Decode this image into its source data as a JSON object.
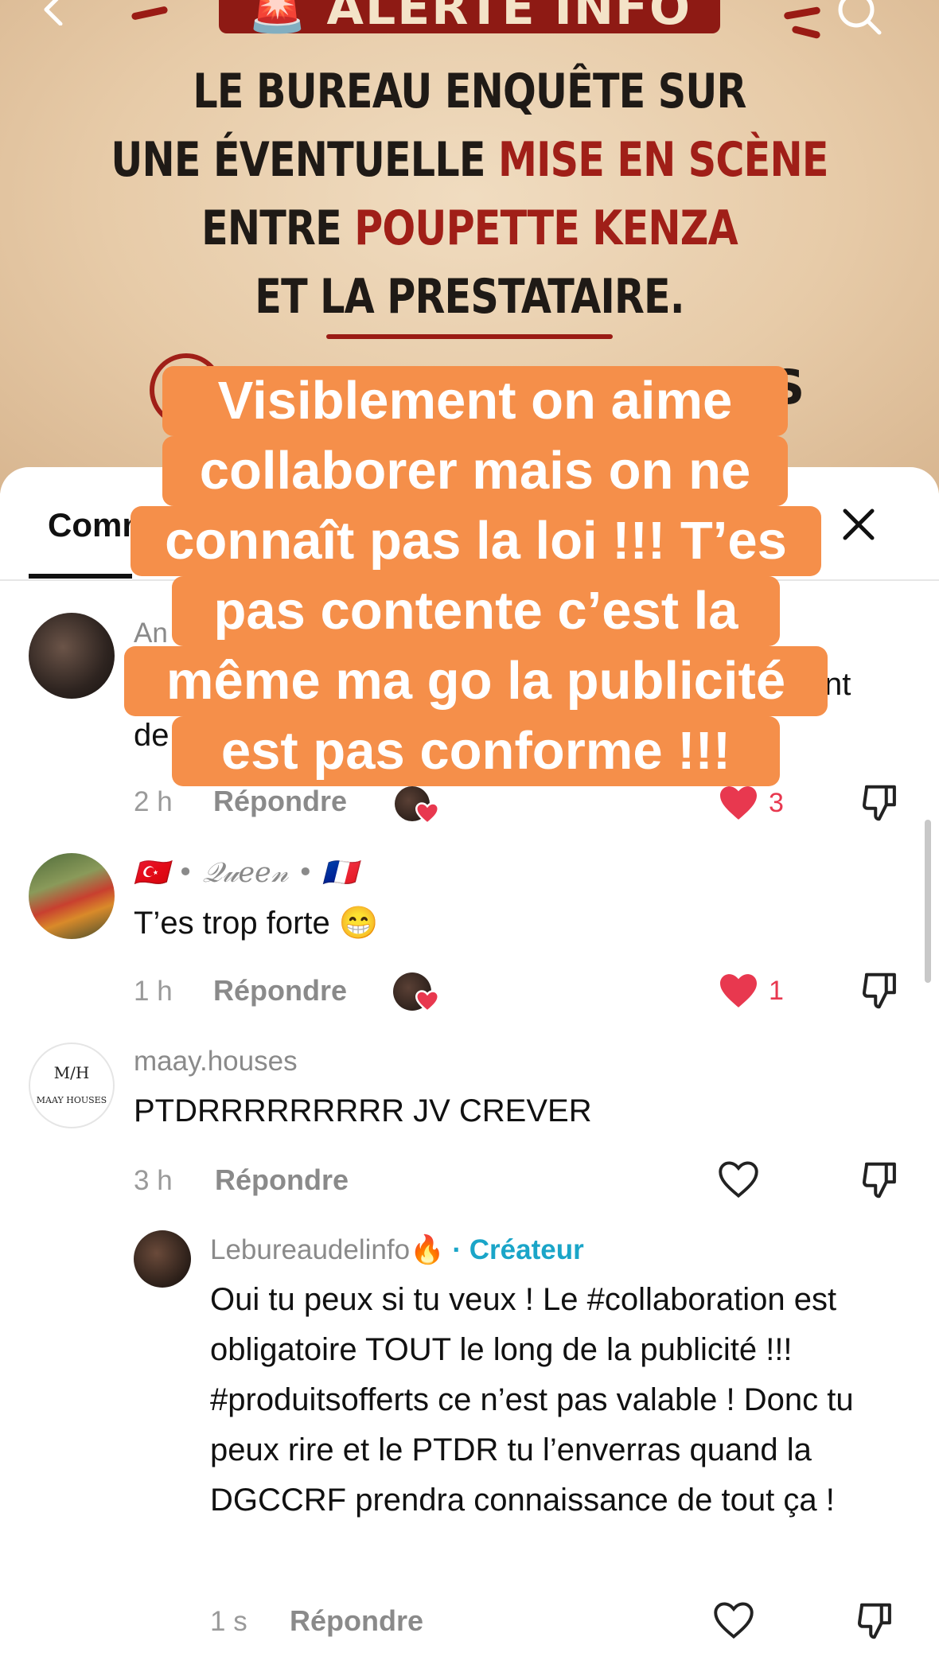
{
  "poster": {
    "banner": "ALERTE INFO",
    "lines": [
      {
        "parts": [
          {
            "text": "LE BUREAU ENQUÊTE SUR",
            "hl": false
          }
        ]
      },
      {
        "parts": [
          {
            "text": "UNE ÉVENTUELLE ",
            "hl": false
          },
          {
            "text": "MISE EN SCÈNE",
            "hl": true
          }
        ]
      },
      {
        "parts": [
          {
            "text": "ENTRE ",
            "hl": false
          },
          {
            "text": "POUPETTE KENZA",
            "hl": true
          }
        ]
      },
      {
        "parts": [
          {
            "text": "ET LA PRESTATAIRE.",
            "hl": false
          }
        ]
      }
    ],
    "trailing_letter": "S"
  },
  "overlay_caption": {
    "lines": [
      "Visiblement on aime",
      "collaborer mais on ne",
      "connaît pas la loi !!! T’es",
      "pas contente c’est la",
      "même ma go la publicité",
      "est pas conforme !!!"
    ]
  },
  "sheet": {
    "tab_label": "Commentaires",
    "close_icon": "close-icon"
  },
  "comments": [
    {
      "username": "An",
      "text_fragment_right": "nt",
      "text_fragment_left": "de",
      "time": "2 h",
      "reply_label": "Répondre",
      "likes": "3",
      "liked": true
    },
    {
      "username": "🇹🇷 • 𝒬𝓊𝑒𝑒𝓃 • 🇫🇷",
      "text": "T’es trop forte 😁",
      "time": "1 h",
      "reply_label": "Répondre",
      "likes": "1",
      "liked": true
    },
    {
      "username": "maay.houses",
      "avatar_text_top": "M/H",
      "avatar_text_bottom": "MAAY HOUSES",
      "text": "PTDRRRRRRRRR JV CREVER",
      "time": "3 h",
      "reply_label": "Répondre",
      "liked": false
    }
  ],
  "reply": {
    "username": "Lebureaudelinfo🔥",
    "creator_badge": "· Créateur",
    "text": "Oui tu peux si tu veux ! Le #collaboration est obligatoire TOUT le long de la publicité !!! #produitsofferts ce n’est pas valable ! Donc tu peux rire et le PTDR tu l’enverras quand la DGCCRF prendra connaissance de tout ça !",
    "time": "1 s",
    "reply_label": "Répondre",
    "liked": false
  },
  "colors": {
    "overlay_orange": "#f58f4a",
    "poster_red": "#a01f18",
    "like_red": "#e8384f",
    "creator_blue": "#1aa5c8"
  }
}
